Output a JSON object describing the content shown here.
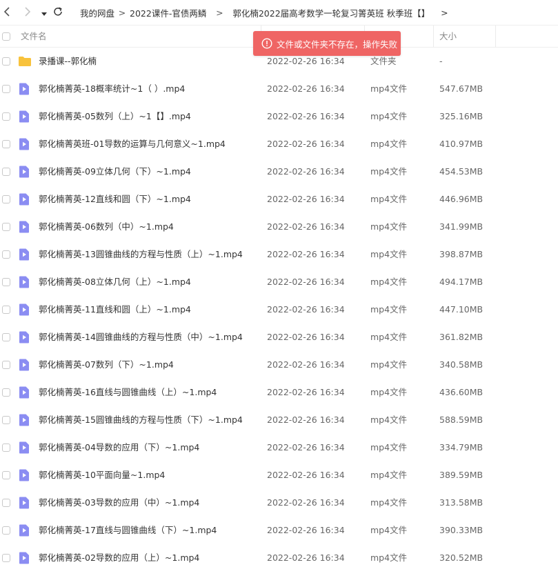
{
  "nav": {
    "back_icon": "chevron-left-icon",
    "forward_icon": "chevron-right-icon",
    "dropdown_icon": "caret-down-icon",
    "refresh_icon": "refresh-icon"
  },
  "breadcrumb": {
    "items": [
      "我的网盘",
      "2022课件-官债两鳞",
      "郭化楠2022届高考数学一轮复习箐英班 秋季班【】"
    ],
    "separator": ">",
    "more": ">"
  },
  "columns": {
    "name": "文件名",
    "size": "大小"
  },
  "toast": {
    "message": "文件或文件夹不存在，操作失败",
    "color": "#ef6564",
    "icon": "alert-circle-icon"
  },
  "colors": {
    "folder": "#f8c23c",
    "video": "#8b8df2",
    "text": "#333333",
    "muted": "#666666"
  },
  "files": [
    {
      "name": "录播课--郭化楠",
      "date": "2022-02-26 16:34",
      "type": "文件夹",
      "size": "-",
      "icon": "folder-icon"
    },
    {
      "name": "郭化楠菁英-18概率统计~1（ ）.mp4",
      "date": "2022-02-26 16:34",
      "type": "mp4文件",
      "size": "547.67MB",
      "icon": "video-file-icon"
    },
    {
      "name": "郭化楠菁英-05数列（上）~1【】.mp4",
      "date": "2022-02-26 16:34",
      "type": "mp4文件",
      "size": "325.16MB",
      "icon": "video-file-icon"
    },
    {
      "name": "郭化楠菁英班-01导数的运算与几何意义~1.mp4",
      "date": "2022-02-26 16:34",
      "type": "mp4文件",
      "size": "410.97MB",
      "icon": "video-file-icon"
    },
    {
      "name": "郭化楠菁英-09立体几何（下）~1.mp4",
      "date": "2022-02-26 16:34",
      "type": "mp4文件",
      "size": "454.53MB",
      "icon": "video-file-icon"
    },
    {
      "name": "郭化楠菁英-12直线和圆（下）~1.mp4",
      "date": "2022-02-26 16:34",
      "type": "mp4文件",
      "size": "446.96MB",
      "icon": "video-file-icon"
    },
    {
      "name": "郭化楠菁英-06数列（中）~1.mp4",
      "date": "2022-02-26 16:34",
      "type": "mp4文件",
      "size": "341.99MB",
      "icon": "video-file-icon"
    },
    {
      "name": "郭化楠菁英-13圆锥曲线的方程与性质（上）~1.mp4",
      "date": "2022-02-26 16:34",
      "type": "mp4文件",
      "size": "398.87MB",
      "icon": "video-file-icon"
    },
    {
      "name": "郭化楠菁英-08立体几何（上）~1.mp4",
      "date": "2022-02-26 16:34",
      "type": "mp4文件",
      "size": "494.17MB",
      "icon": "video-file-icon"
    },
    {
      "name": "郭化楠菁英-11直线和圆（上）~1.mp4",
      "date": "2022-02-26 16:34",
      "type": "mp4文件",
      "size": "447.10MB",
      "icon": "video-file-icon"
    },
    {
      "name": "郭化楠菁英-14圆锥曲线的方程与性质（中）~1.mp4",
      "date": "2022-02-26 16:34",
      "type": "mp4文件",
      "size": "361.82MB",
      "icon": "video-file-icon"
    },
    {
      "name": "郭化楠菁英-07数列（下）~1.mp4",
      "date": "2022-02-26 16:34",
      "type": "mp4文件",
      "size": "340.58MB",
      "icon": "video-file-icon"
    },
    {
      "name": "郭化楠菁英-16直线与圆锥曲线（上）~1.mp4",
      "date": "2022-02-26 16:34",
      "type": "mp4文件",
      "size": "436.60MB",
      "icon": "video-file-icon"
    },
    {
      "name": "郭化楠菁英-15圆锥曲线的方程与性质（下）~1.mp4",
      "date": "2022-02-26 16:34",
      "type": "mp4文件",
      "size": "588.59MB",
      "icon": "video-file-icon"
    },
    {
      "name": "郭化楠菁英-04导数的应用（下）~1.mp4",
      "date": "2022-02-26 16:34",
      "type": "mp4文件",
      "size": "334.79MB",
      "icon": "video-file-icon"
    },
    {
      "name": "郭化楠菁英-10平面向量~1.mp4",
      "date": "2022-02-26 16:34",
      "type": "mp4文件",
      "size": "389.59MB",
      "icon": "video-file-icon"
    },
    {
      "name": "郭化楠菁英-03导数的应用（中）~1.mp4",
      "date": "2022-02-26 16:34",
      "type": "mp4文件",
      "size": "313.58MB",
      "icon": "video-file-icon"
    },
    {
      "name": "郭化楠菁英-17直线与圆锥曲线（下）~1.mp4",
      "date": "2022-02-26 16:34",
      "type": "mp4文件",
      "size": "390.33MB",
      "icon": "video-file-icon"
    },
    {
      "name": "郭化楠菁英-02导数的应用（上）~1.mp4",
      "date": "2022-02-26 16:34",
      "type": "mp4文件",
      "size": "320.52MB",
      "icon": "video-file-icon"
    }
  ]
}
